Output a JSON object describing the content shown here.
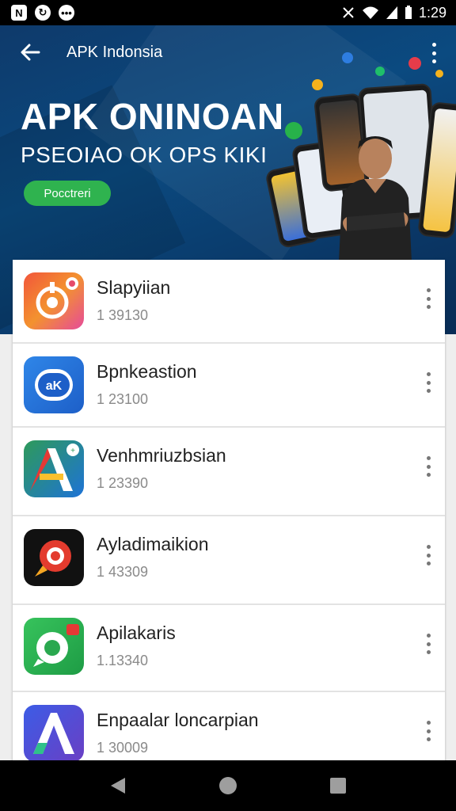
{
  "status_bar": {
    "time": "1:29",
    "left_icons": [
      "notification-n-icon",
      "sync-icon",
      "message-icon"
    ],
    "right_icons": [
      "mute-icon",
      "wifi-icon",
      "signal-icon",
      "battery-icon"
    ]
  },
  "toolbar": {
    "title": "APK Indonsia",
    "back_icon": "arrow-left-icon",
    "overflow_icon": "more-vert-icon"
  },
  "banner": {
    "headline": "APK ONINOAN",
    "subhead": "PSEOIAO OK OPS KIKI",
    "button_label": "Pocctreri"
  },
  "apps": [
    {
      "name": "Slapyiian",
      "size": "1 39130",
      "icon": "orange-target-icon"
    },
    {
      "name": "Bpnkeastion",
      "size": "1 23100",
      "icon": "blue-apk-icon"
    },
    {
      "name": "Venhmriuzbsian",
      "size": "1 23390",
      "icon": "colorful-a-icon"
    },
    {
      "name": "Ayladimaikion",
      "size": "1 43309",
      "icon": "red-ring-icon"
    },
    {
      "name": "Apilakaris",
      "size": "1.13340",
      "icon": "green-chat-icon"
    },
    {
      "name": "Enpaalar loncarpian",
      "size": "1 30009",
      "icon": "blue-a-icon"
    }
  ],
  "nav_bar": {
    "icons": [
      "nav-back-icon",
      "nav-home-icon",
      "nav-recents-icon"
    ]
  },
  "colors": {
    "banner_bg": "#0b4a80",
    "button_green": "#2fb34f",
    "list_bg": "#ffffff"
  }
}
